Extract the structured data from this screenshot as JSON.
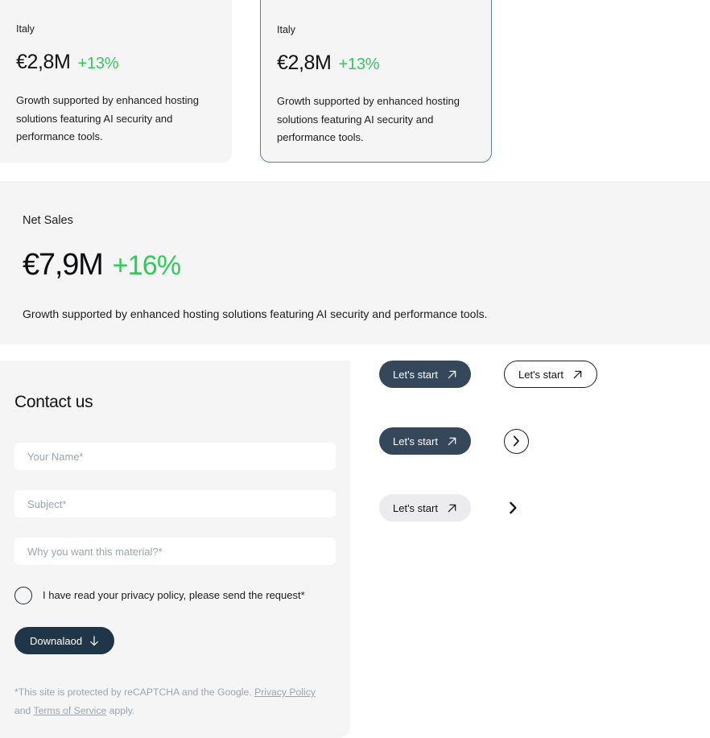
{
  "stat_cards": [
    {
      "region": "Italy",
      "value": "€2,8M",
      "delta": "+13%",
      "description": "Growth supported by enhanced hosting solutions featuring AI security and performance tools."
    },
    {
      "region": "Italy",
      "value": "€2,8M",
      "delta": "+13%",
      "description": "Growth supported by enhanced hosting solutions featuring AI security and performance tools."
    }
  ],
  "net_sales": {
    "label": "Net Sales",
    "value": "€7,9M",
    "delta": "+16%",
    "description": "Growth supported by enhanced hosting solutions featuring AI security and performance tools."
  },
  "contact": {
    "title": "Contact us",
    "fields": [
      {
        "placeholder": "Your Name*",
        "value": ""
      },
      {
        "placeholder": "Subject*",
        "value": ""
      },
      {
        "placeholder": "Why you want this material?*",
        "value": ""
      }
    ],
    "consent_label": "I have read your privacy policy, please send the request*",
    "submit_label": "Downalaod",
    "submit_icon": "arrow-down-icon",
    "legal": {
      "lead": "*This site is protected by reCAPTCHA and the Google. ",
      "privacy_link": "Privacy Policy",
      "conjunction": " and ",
      "terms_link": "Terms of Service",
      "tail": " apply."
    }
  },
  "button_showcase": {
    "rows": [
      {
        "primary_label": "Let's start",
        "primary_icon": "arrow-up-right-icon",
        "secondary_label": "Let's start",
        "secondary_icon": "arrow-up-right-icon"
      },
      {
        "primary_label": "Let's start",
        "primary_icon": "arrow-up-right-icon",
        "secondary_label": "",
        "secondary_icon": "chevron-right-icon"
      },
      {
        "primary_label": "Let's start",
        "primary_icon": "arrow-up-right-icon",
        "secondary_label": "",
        "secondary_icon": "chevron-right-icon"
      }
    ]
  },
  "colors": {
    "panel_bg": "#f5f5f6",
    "accent_green": "#2ecc5b",
    "dark_navy": "#1f3648",
    "slate_button": "#35475a",
    "card_border": "#5b7f96",
    "muted_text": "#9aa6ac"
  }
}
